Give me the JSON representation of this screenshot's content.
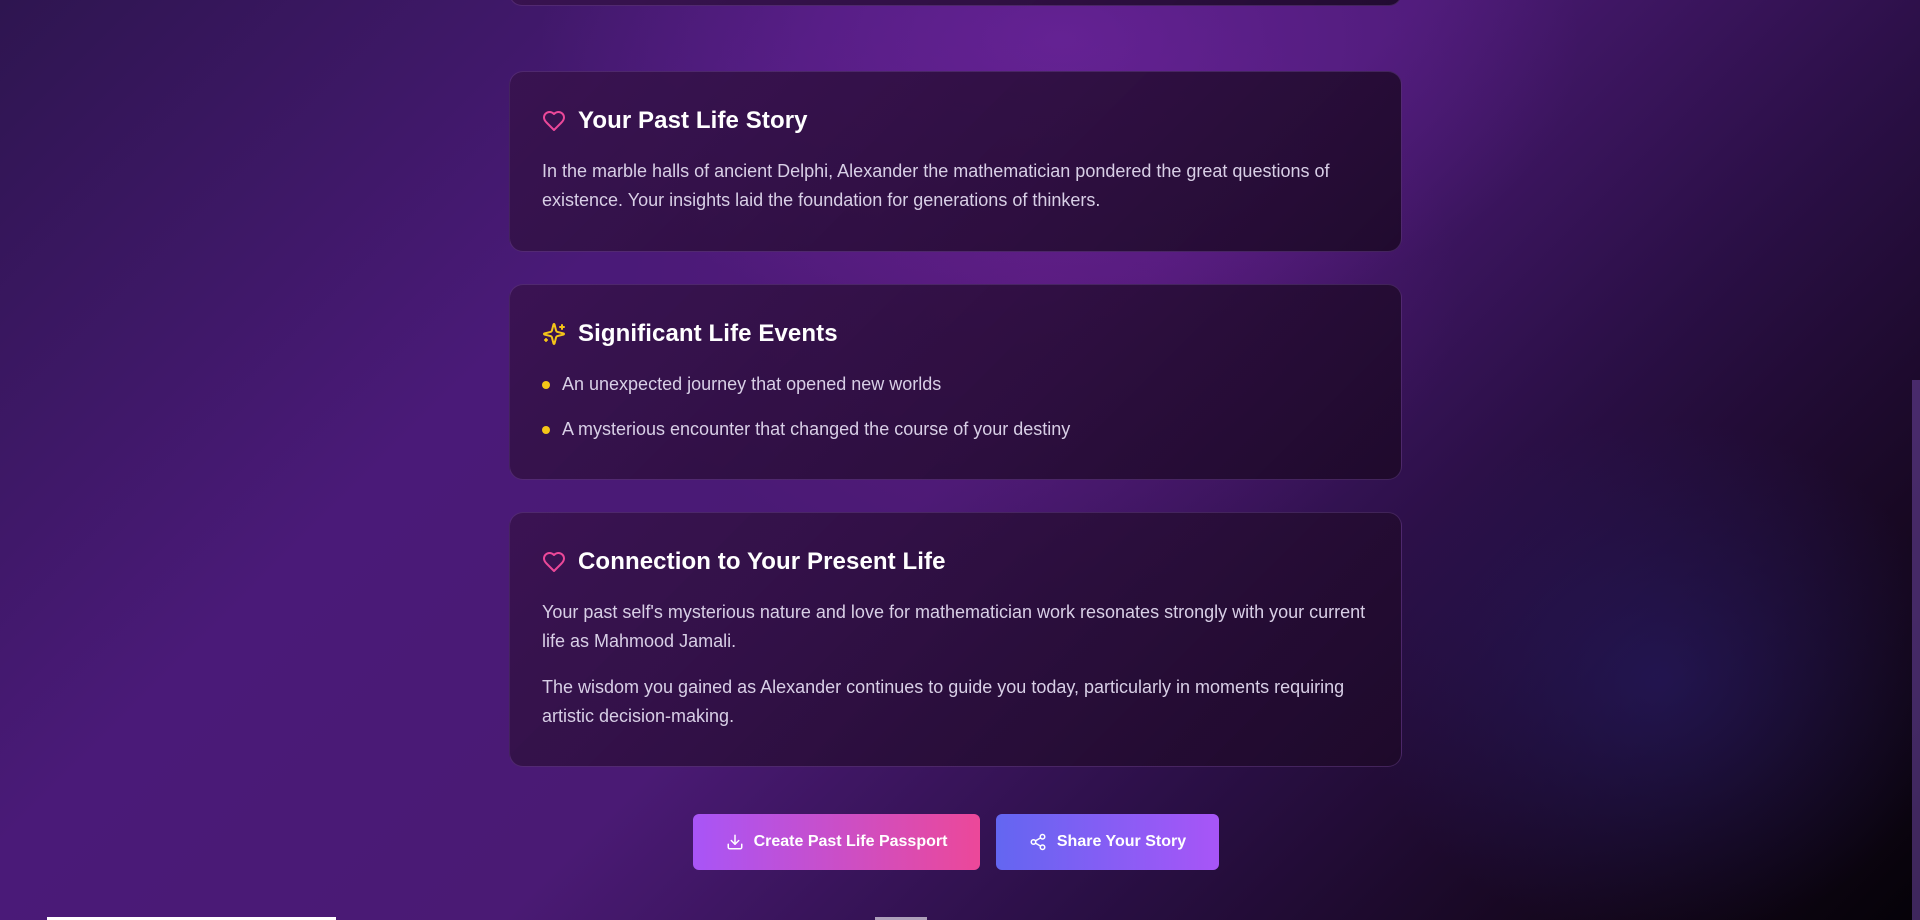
{
  "sections": {
    "story": {
      "icon": "heart-icon",
      "title": "Your Past Life Story",
      "paragraphs": [
        "In the marble halls of ancient Delphi, Alexander the mathematician pondered the great questions of existence. Your insights laid the foundation for generations of thinkers."
      ]
    },
    "events": {
      "icon": "sparkles-icon",
      "title": "Significant Life Events",
      "items": [
        "An unexpected journey that opened new worlds",
        "A mysterious encounter that changed the course of your destiny"
      ]
    },
    "present": {
      "icon": "heart-icon",
      "title": "Connection to Your Present Life",
      "paragraphs": [
        "Your past self's mysterious nature and love for mathematician work resonates strongly with your current life as Mahmood Jamali.",
        "The wisdom you gained as Alexander continues to guide you today, particularly in moments requiring artistic decision-making."
      ]
    }
  },
  "actions": {
    "passport_label": "Create Past Life Passport",
    "passport_icon": "download-icon",
    "share_label": "Share Your Story",
    "share_icon": "share-icon"
  },
  "colors": {
    "heart": "#ec4899",
    "sparkles": "#f5c518",
    "bullet": "#f5c518",
    "passport_gradient": [
      "#a855f7",
      "#ec4899"
    ],
    "share_gradient": [
      "#6366f1",
      "#a855f7"
    ]
  }
}
